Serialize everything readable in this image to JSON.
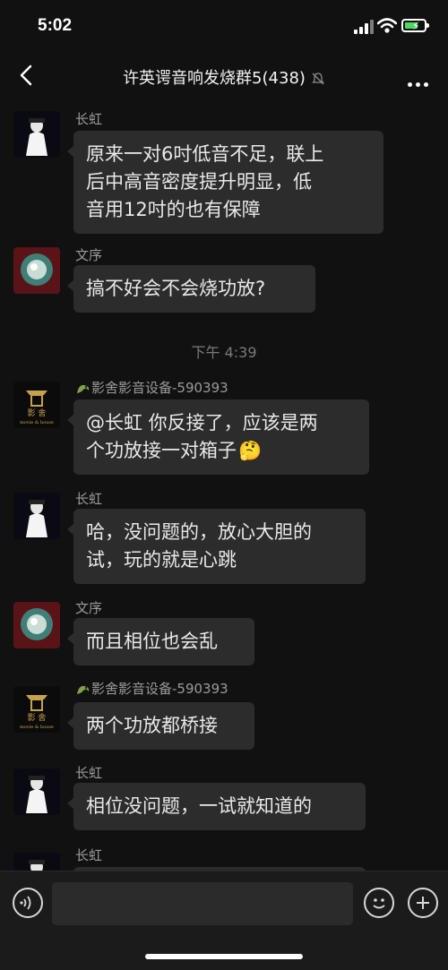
{
  "status": {
    "time": "5:02"
  },
  "header": {
    "title": "许英谔音响发烧群5(438)"
  },
  "messages": [
    {
      "sender": "长虹",
      "text_lines": [
        "原来一对6吋低音不足，联上",
        "后中高音密度提升明显，低",
        "音用12吋的也有保障"
      ]
    },
    {
      "sender": "文序",
      "text": "搞不好会不会烧功放?"
    },
    {
      "timestamp": "下午 4:39"
    },
    {
      "sender": "影舍影音设备-590393",
      "text_lines": [
        "@长虹 你反接了，应该是两",
        "个功放接一对箱子"
      ],
      "emoji": "🤔"
    },
    {
      "sender": "长虹",
      "text_lines": [
        "哈，没问题的，放心大胆的",
        "试，玩的就是心跳"
      ]
    },
    {
      "sender": "文序",
      "text": "而且相位也会乱"
    },
    {
      "sender": "影舍影音设备-590393",
      "text": "两个功放都桥接"
    },
    {
      "sender": "长虹",
      "text": "相位没问题，一试就知道的"
    },
    {
      "sender": "长虹"
    }
  ],
  "avatar_texts": {
    "logo_line1": "影 舍",
    "logo_line2": "movie & house"
  },
  "icons": [
    "back-icon",
    "mute-icon",
    "more-icon",
    "voice-icon",
    "emoji-icon",
    "plus-icon"
  ],
  "colors": {
    "background": "#111111",
    "bubble": "#2c2c2c",
    "battery": "#4cd964"
  }
}
